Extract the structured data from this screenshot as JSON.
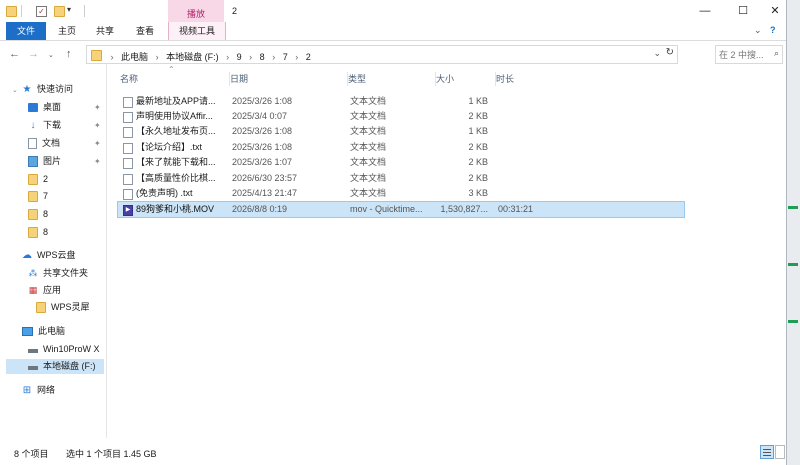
{
  "window": {
    "title": "2"
  },
  "ribbon": {
    "context_group": "播放",
    "tabs": [
      {
        "label": "文件"
      },
      {
        "label": "主页"
      },
      {
        "label": "共享"
      },
      {
        "label": "查看"
      },
      {
        "label": "视频工具"
      }
    ]
  },
  "address": {
    "breadcrumbs": [
      "此电脑",
      "本地磁盘 (F:)",
      "9",
      "8",
      "7",
      "2"
    ],
    "search_placeholder": "在 2 中搜..."
  },
  "nav": {
    "items": [
      {
        "label": "快速访问",
        "icon": "star-icon",
        "type": "header"
      },
      {
        "label": "桌面",
        "icon": "desktop-icon",
        "pinned": true
      },
      {
        "label": "下载",
        "icon": "download-icon",
        "pinned": true
      },
      {
        "label": "文档",
        "icon": "document-icon",
        "pinned": true
      },
      {
        "label": "图片",
        "icon": "pictures-icon",
        "pinned": true
      },
      {
        "label": "2",
        "icon": "folder-icon"
      },
      {
        "label": "7",
        "icon": "folder-icon"
      },
      {
        "label": "8",
        "icon": "folder-icon"
      },
      {
        "label": "8",
        "icon": "folder-icon"
      },
      {
        "label": "WPS云盘",
        "icon": "cloud-icon",
        "type": "header"
      },
      {
        "label": "共享文件夹",
        "icon": "share-icon"
      },
      {
        "label": "应用",
        "icon": "app-icon"
      },
      {
        "label": "WPS灵犀",
        "icon": "folder-icon"
      },
      {
        "label": "此电脑",
        "icon": "computer-icon",
        "type": "header"
      },
      {
        "label": "Win10ProW X",
        "icon": "drive-icon"
      },
      {
        "label": "本地磁盘 (F:)",
        "icon": "drive-icon",
        "selected": true
      },
      {
        "label": "网络",
        "icon": "network-icon",
        "type": "header"
      }
    ]
  },
  "columns": [
    "名称",
    "日期",
    "类型",
    "大小",
    "时长"
  ],
  "files": [
    {
      "name": "最新地址及APP请...",
      "date": "2025/3/26 1:08",
      "type": "文本文档",
      "size": "1 KB",
      "duration": "",
      "icon": "text-file-icon"
    },
    {
      "name": "声明使用协议Affir...",
      "date": "2025/3/4 0:07",
      "type": "文本文档",
      "size": "2 KB",
      "duration": "",
      "icon": "text-file-icon"
    },
    {
      "name": "【永久地址发布页...",
      "date": "2025/3/26 1:08",
      "type": "文本文档",
      "size": "1 KB",
      "duration": "",
      "icon": "text-file-icon"
    },
    {
      "name": "【论坛介绍】.txt",
      "date": "2025/3/26 1:08",
      "type": "文本文档",
      "size": "2 KB",
      "duration": "",
      "icon": "text-file-icon"
    },
    {
      "name": "【来了就能下载和...",
      "date": "2025/3/26 1:07",
      "type": "文本文档",
      "size": "2 KB",
      "duration": "",
      "icon": "text-file-icon"
    },
    {
      "name": "【高质量性价比棋...",
      "date": "2026/6/30 23:57",
      "type": "文本文档",
      "size": "2 KB",
      "duration": "",
      "icon": "text-file-icon"
    },
    {
      "name": "(免责声明) .txt",
      "date": "2025/4/13 21:47",
      "type": "文本文档",
      "size": "3 KB",
      "duration": "",
      "icon": "text-file-icon"
    },
    {
      "name": "89狗爹和小桃.MOV",
      "date": "2026/8/8 0:19",
      "type": "mov - Quicktime...",
      "size": "1,530,827...",
      "duration": "00:31:21",
      "icon": "video-file-icon",
      "selected": true
    }
  ],
  "status": {
    "item_count": "8 个项目",
    "selection": "选中 1 个项目  1.45 GB"
  }
}
